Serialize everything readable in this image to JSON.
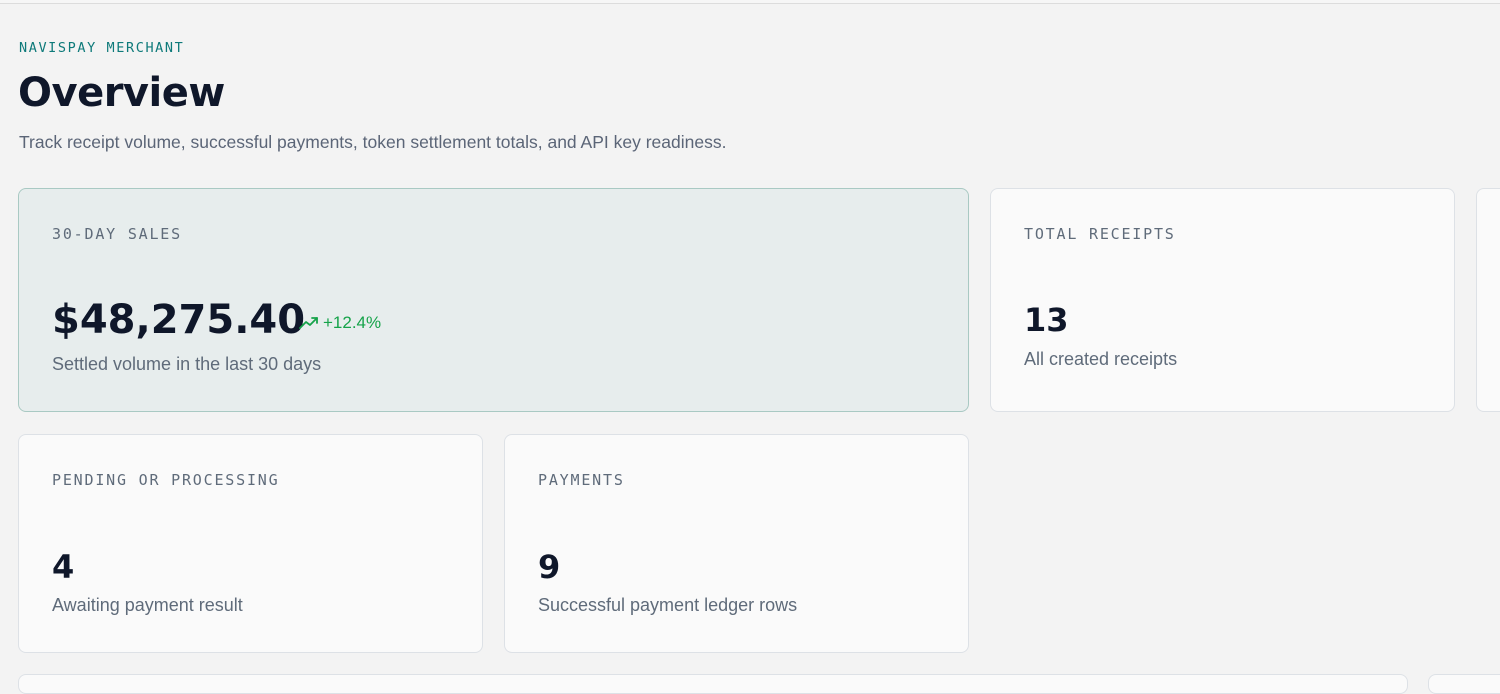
{
  "header": {
    "eyebrow": "NAVISPAY MERCHANT",
    "title": "Overview",
    "subtitle": "Track receipt volume, successful payments, token settlement totals, and API key readiness."
  },
  "cards": {
    "sales": {
      "label": "30-DAY SALES",
      "value": "$48,275.40",
      "trend": "+12.4%",
      "trend_icon": "trending-up-icon",
      "description": "Settled volume in the last 30 days"
    },
    "receipts": {
      "label": "TOTAL RECEIPTS",
      "value": "13",
      "description": "All created receipts"
    },
    "pending": {
      "label": "PENDING OR PROCESSING",
      "value": "4",
      "description": "Awaiting payment result"
    },
    "payments": {
      "label": "PAYMENTS",
      "value": "9",
      "description": "Successful payment ledger rows"
    }
  },
  "colors": {
    "accent_teal": "#0e7a7a",
    "trend_green": "#16a34a",
    "featured_bg": "#e7eded",
    "featured_border": "#a9c9c3"
  }
}
